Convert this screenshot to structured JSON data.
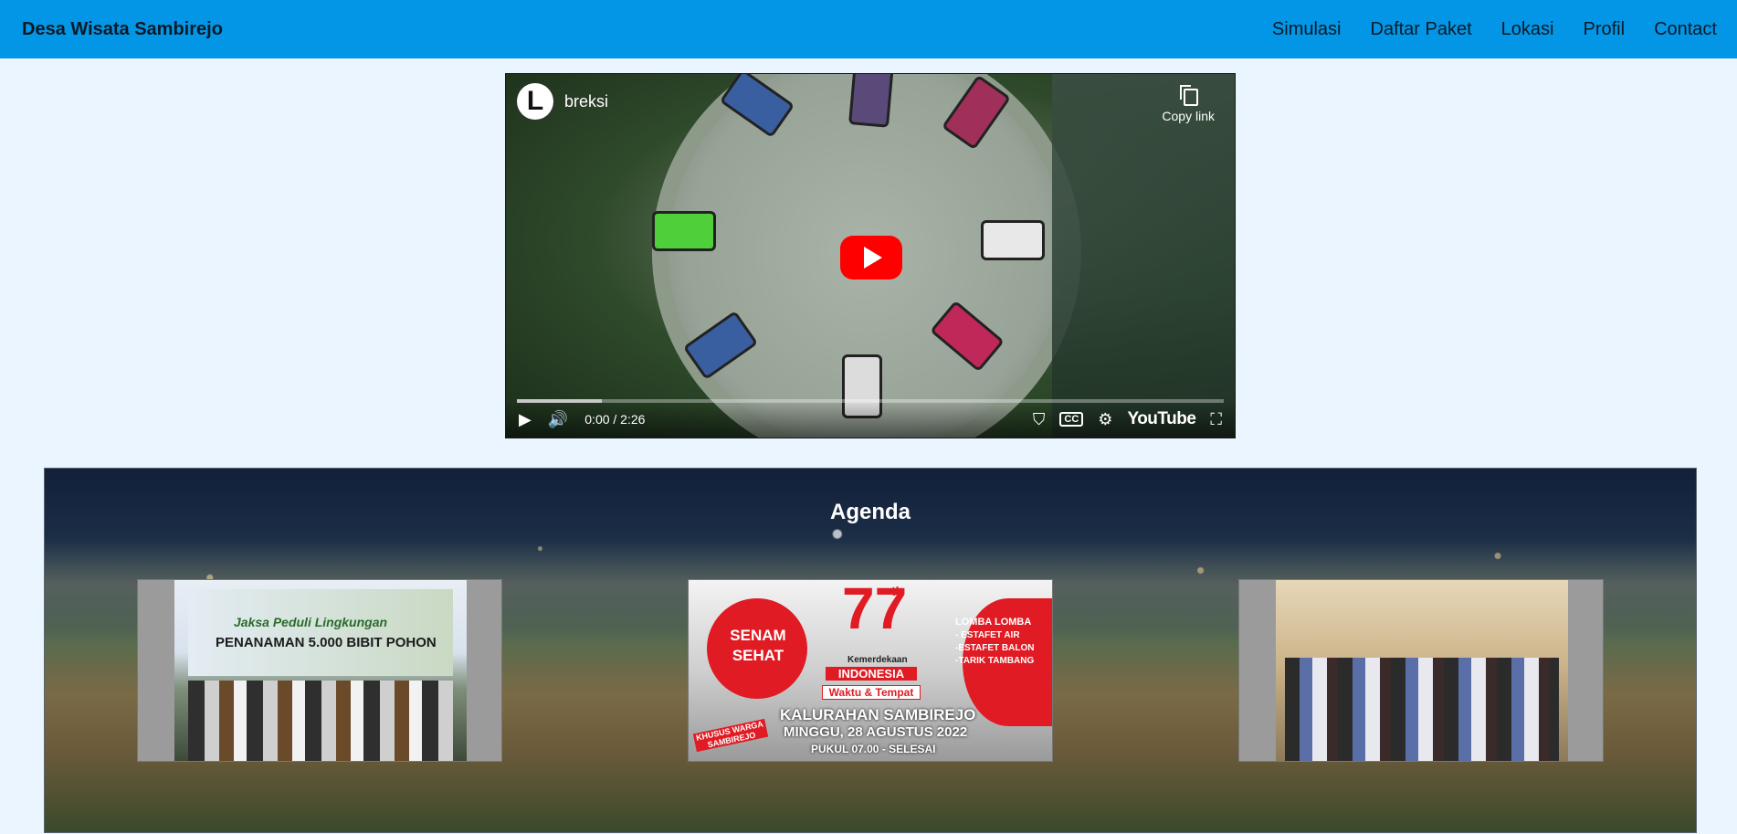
{
  "navbar": {
    "brand": "Desa Wisata Sambirejo",
    "links": [
      "Simulasi",
      "Daftar Paket",
      "Lokasi",
      "Profil",
      "Contact"
    ]
  },
  "video": {
    "channel_initial": "L",
    "channel_name": "breksi",
    "copy_link_label": "Copy link",
    "time": "0:00 / 2:26",
    "youtube_label": "YouTube",
    "cc_label": "CC",
    "progress_fraction": 0.12
  },
  "agenda": {
    "title": "Agenda",
    "cards": [
      {
        "alt": "Jaksa Peduli Lingkungan - Penanaman 5.000 Bibit Pohon"
      },
      {
        "alt": "Senam Sehat 77th Kemerdekaan Indonesia - Kalurahan Sambirejo, Minggu 28 Agustus 2022"
      },
      {
        "alt": "Kegiatan warga di Kalurahan Sambirejo"
      }
    ],
    "card1_text": {
      "line1": "Jaksa Peduli Lingkungan",
      "line2": "PENANAMAN 5.000 BIBIT POHON"
    },
    "card2_text": {
      "senam": "SENAM SEHAT",
      "seventy_seven": "77",
      "th": "th",
      "kemerdekaan": "Kemerdekaan",
      "indonesia": "INDONESIA",
      "waktu": "Waktu & Tempat",
      "lomba": "LOMBA LOMBA",
      "lomba_items": [
        "- ESTAFET AIR",
        "-ESTAFET BALON",
        "-TARIK TAMBANG"
      ],
      "place": "KALURAHAN SAMBIREJO",
      "date": "MINGGU, 28 AGUSTUS 2022",
      "time": "PUKUL 07.00 - SELESAI",
      "khusus": "KHUSUS WARGA SAMBIREJO"
    }
  },
  "colors": {
    "navbar": "#0396e6",
    "page_bg": "#eaf5ff",
    "youtube_red": "#ff0000",
    "accent_red": "#e01b24"
  }
}
